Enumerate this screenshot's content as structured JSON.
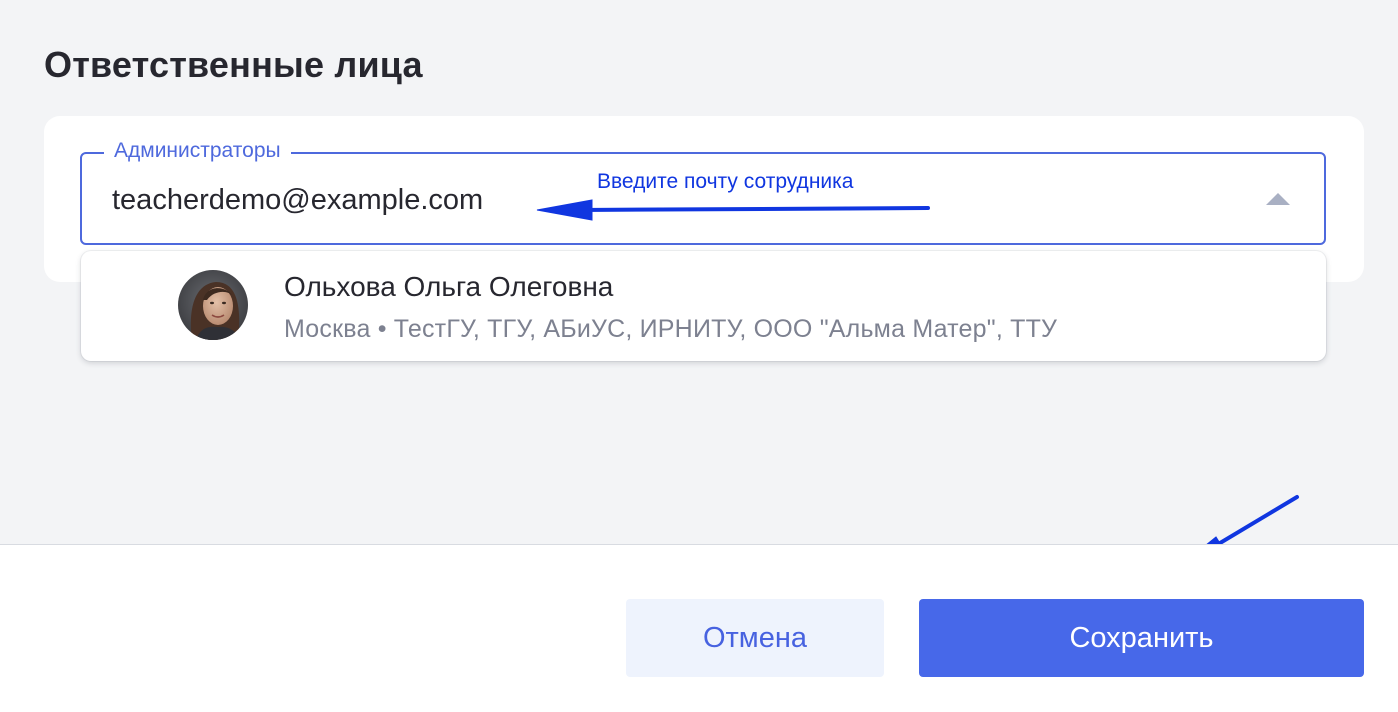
{
  "page": {
    "title": "Ответственные лица"
  },
  "field": {
    "legend": "Администраторы",
    "value": "teacherdemo@example.com"
  },
  "dropdown": {
    "options": [
      {
        "name": "Ольхова Ольга Олеговна",
        "meta": "Москва • ТестГУ, ТГУ, АБиУС, ИРНИТУ, ООО \"Альма Матер\", ТТУ"
      }
    ]
  },
  "annotation": {
    "text": "Введите почту сотрудника",
    "color": "#1036e0"
  },
  "footer": {
    "cancel_label": "Отмена",
    "save_label": "Сохранить"
  },
  "colors": {
    "accent": "#4768e9",
    "field_border": "#4e69dd",
    "background": "#f3f4f6"
  }
}
